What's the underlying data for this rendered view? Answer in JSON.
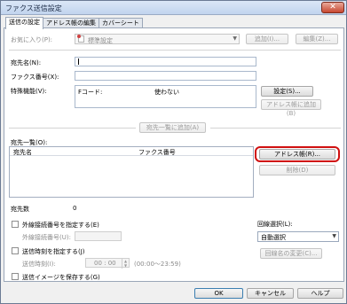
{
  "window": {
    "title": "ファクス送信設定",
    "close_glyph": "✕"
  },
  "tabs": [
    {
      "label": "送信の設定",
      "active": true
    },
    {
      "label": "アドレス帳の編集",
      "active": false
    },
    {
      "label": "カバーシート",
      "active": false
    }
  ],
  "favorites": {
    "label": "お気に入り(P):",
    "value": "標準設定",
    "add_button": "追加(I)...",
    "edit_button": "編集(Z)..."
  },
  "form": {
    "recipient_name_label": "宛先名(N):",
    "recipient_name_value": "",
    "fax_number_label": "ファクス番号(X):",
    "fax_number_value": "",
    "special_function_label": "特殊機能(V):",
    "fcode_label": "Fコード:",
    "fcode_value": "使わない",
    "settings_button": "設定(S)...",
    "add_to_addressbook_button": "アドレス帳に追加(B)",
    "add_to_list_button": "宛先一覧に追加(A)"
  },
  "recipients": {
    "section_label": "宛先一覧(O):",
    "columns": [
      "宛先名",
      "ファクス番号"
    ],
    "rows": [],
    "addressbook_button": "アドレス帳(R)...",
    "delete_button": "削除(D)",
    "count_label": "宛先数",
    "count_value": "0"
  },
  "outside_line": {
    "checkbox_label": "外線接続番号を指定する(E)",
    "number_label": "外線接続番号(U):",
    "number_value": ""
  },
  "send_time": {
    "checkbox_label": "送信時刻を指定する(J)",
    "time_label": "送信時刻(I):",
    "time_value": "00 : 00",
    "range_hint": "(00:00〜23:59)"
  },
  "save_image": {
    "checkbox_label": "送信イメージを保存する(G)"
  },
  "line_select": {
    "label": "回線選択(L):",
    "value": "自動選択",
    "line_name_button": "回線名の変更(C)..."
  },
  "footer": {
    "ok": "OK",
    "cancel": "キャンセル",
    "help": "ヘルプ"
  },
  "colors": {
    "highlight": "#d01010"
  }
}
